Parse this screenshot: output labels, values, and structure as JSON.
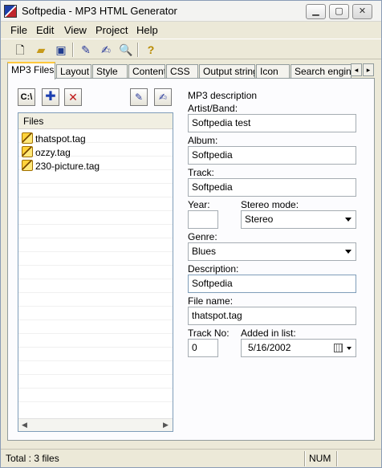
{
  "window": {
    "title": "Softpedia - MP3 HTML Generator"
  },
  "menu": [
    "File",
    "Edit",
    "View",
    "Project",
    "Help"
  ],
  "tabs": [
    "MP3 Files",
    "Layout",
    "Style",
    "Content",
    "CSS",
    "Output string",
    "Icon",
    "Search engine"
  ],
  "file_list": {
    "header": "Files",
    "items": [
      "thatspot.tag",
      "ozzy.tag",
      "230-picture.tag"
    ]
  },
  "form": {
    "group_title": "MP3 description",
    "artist_label": "Artist/Band:",
    "artist_value": "Softpedia test",
    "album_label": "Album:",
    "album_value": "Softpedia",
    "track_label": "Track:",
    "track_value": "Softpedia",
    "year_label": "Year:",
    "year_value": "",
    "stereo_label": "Stereo mode:",
    "stereo_value": "Stereo",
    "genre_label": "Genre:",
    "genre_value": "Blues",
    "description_label": "Description:",
    "description_value": "Softpedia",
    "filename_label": "File name:",
    "filename_value": "thatspot.tag",
    "trackno_label": "Track No:",
    "trackno_value": "0",
    "added_label": "Added in list:",
    "added_value": "5/16/2002"
  },
  "status": {
    "total": "Total : 3 files",
    "num": "NUM"
  }
}
